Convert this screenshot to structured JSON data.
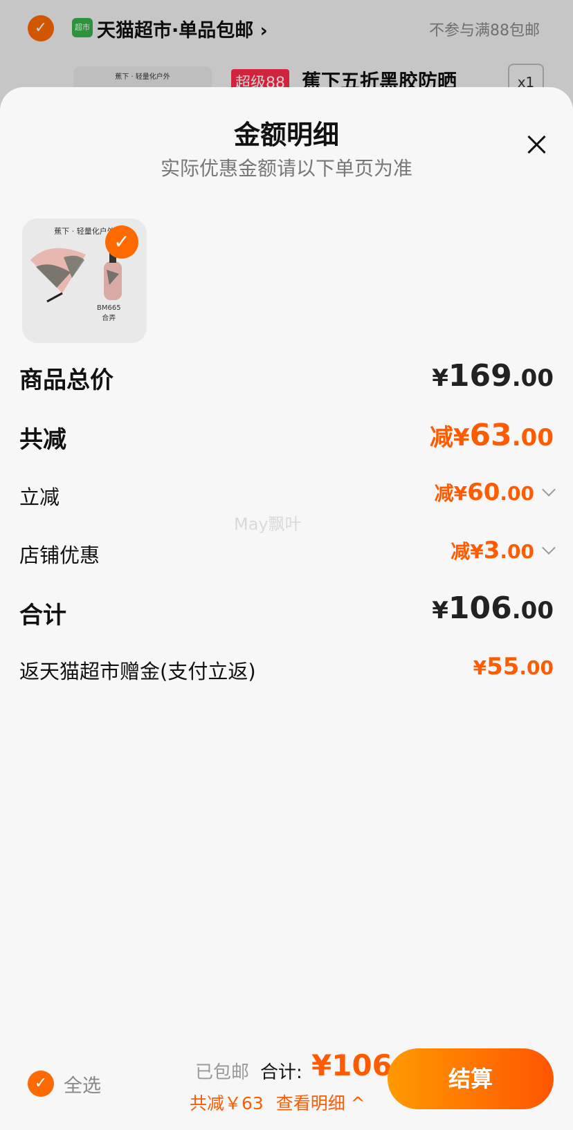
{
  "background": {
    "store_name": "天猫超市·单品包邮 ›",
    "store_icon_text": "超市",
    "note": "不参与满88包邮",
    "thumb_text": "蕉下 · 轻量化户外",
    "tag": "超级88",
    "title": "蕉下五折黑胶防晒",
    "qty": "x1"
  },
  "sheet": {
    "title": "金额明细",
    "subtitle": "实际优惠金额请以下单页为准"
  },
  "product": {
    "brand_text": "蕉下 · 轻量化户外",
    "code": "BM665",
    "code_sub": "合弄"
  },
  "rows": {
    "total": {
      "label": "商品总价",
      "currency": "¥",
      "int": "169",
      "dec": ".00"
    },
    "reduce_all": {
      "label": "共减",
      "prefix": "减",
      "currency": "¥",
      "int": "63",
      "dec": ".00"
    },
    "instant": {
      "label": "立减",
      "prefix": "减",
      "currency": "¥",
      "int": "60",
      "dec": ".00"
    },
    "shop": {
      "label": "店铺优惠",
      "prefix": "减",
      "currency": "¥",
      "int": "3",
      "dec": ".00"
    },
    "sum": {
      "label": "合计",
      "currency": "¥",
      "int": "106",
      "dec": ".00"
    },
    "rebate": {
      "label": "返天猫超市赠金(支付立返)",
      "currency": "¥",
      "int": "55",
      "dec": ".00"
    }
  },
  "watermark": "May飘叶",
  "bottom": {
    "select_all": "全选",
    "shipped": "已包邮",
    "total_label": "合计:",
    "total_value": "¥106",
    "discount": "共减￥63",
    "detail_link": "查看明细 ^",
    "pay": "结算"
  },
  "colors": {
    "accent": "#ff5b00",
    "checkbox": "#ff6a00"
  }
}
